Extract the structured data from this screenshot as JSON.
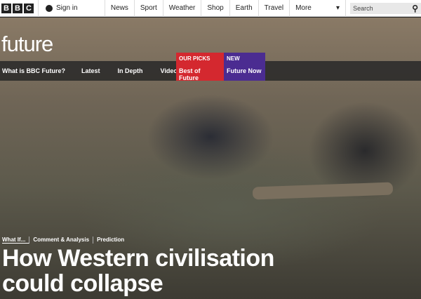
{
  "header": {
    "logo": [
      "B",
      "B",
      "C"
    ],
    "sign_in": "Sign in",
    "nav": [
      "News",
      "Sport",
      "Weather",
      "Shop",
      "Earth",
      "Travel"
    ],
    "more": "More",
    "more_arrow": "▾",
    "search_placeholder": "Search",
    "search_icon": "⚲"
  },
  "brand": "future",
  "subnav": [
    "What is BBC Future?",
    "Latest",
    "In Depth",
    "Video"
  ],
  "picks": [
    {
      "kicker": "OUR PICKS",
      "label": "Best of Future",
      "color": "#d4282f"
    },
    {
      "kicker": "NEW",
      "label": "Future Now",
      "color": "#4b2c91"
    }
  ],
  "article": {
    "tags": [
      "What If...",
      "Comment & Analysis",
      "Prediction"
    ],
    "title": "How Western civilisation could collapse"
  }
}
